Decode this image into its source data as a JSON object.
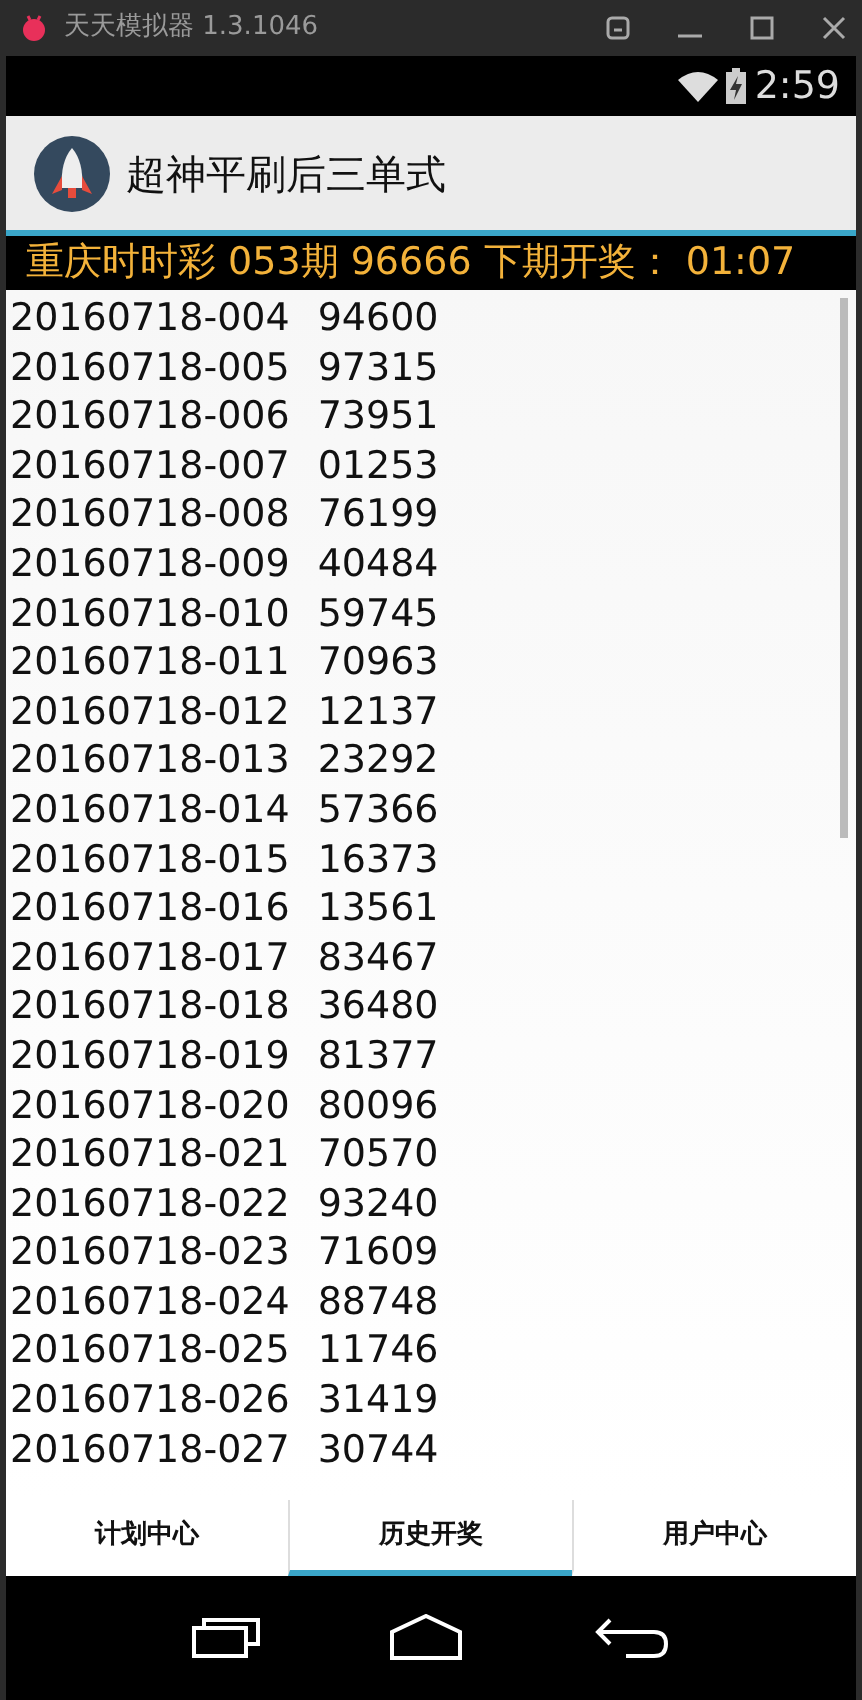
{
  "emulator": {
    "title": "天天模拟器 1.3.1046"
  },
  "status_bar": {
    "time": "2:59"
  },
  "app_bar": {
    "title": "超神平刷后三单式"
  },
  "ticker": {
    "text": "重庆时时彩 053期 96666 下期开奖： 01:07"
  },
  "draws": [
    {
      "issue": "20160718-004",
      "number": "94600"
    },
    {
      "issue": "20160718-005",
      "number": "97315"
    },
    {
      "issue": "20160718-006",
      "number": "73951"
    },
    {
      "issue": "20160718-007",
      "number": "01253"
    },
    {
      "issue": "20160718-008",
      "number": "76199"
    },
    {
      "issue": "20160718-009",
      "number": "40484"
    },
    {
      "issue": "20160718-010",
      "number": "59745"
    },
    {
      "issue": "20160718-011",
      "number": "70963"
    },
    {
      "issue": "20160718-012",
      "number": "12137"
    },
    {
      "issue": "20160718-013",
      "number": "23292"
    },
    {
      "issue": "20160718-014",
      "number": "57366"
    },
    {
      "issue": "20160718-015",
      "number": "16373"
    },
    {
      "issue": "20160718-016",
      "number": "13561"
    },
    {
      "issue": "20160718-017",
      "number": "83467"
    },
    {
      "issue": "20160718-018",
      "number": "36480"
    },
    {
      "issue": "20160718-019",
      "number": "81377"
    },
    {
      "issue": "20160718-020",
      "number": "80096"
    },
    {
      "issue": "20160718-021",
      "number": "70570"
    },
    {
      "issue": "20160718-022",
      "number": "93240"
    },
    {
      "issue": "20160718-023",
      "number": "71609"
    },
    {
      "issue": "20160718-024",
      "number": "88748"
    },
    {
      "issue": "20160718-025",
      "number": "11746"
    },
    {
      "issue": "20160718-026",
      "number": "31419"
    },
    {
      "issue": "20160718-027",
      "number": "30744"
    }
  ],
  "tabs": [
    {
      "label": "计划中心",
      "selected": false
    },
    {
      "label": "历史开奖",
      "selected": true
    },
    {
      "label": "用户中心",
      "selected": false
    }
  ]
}
